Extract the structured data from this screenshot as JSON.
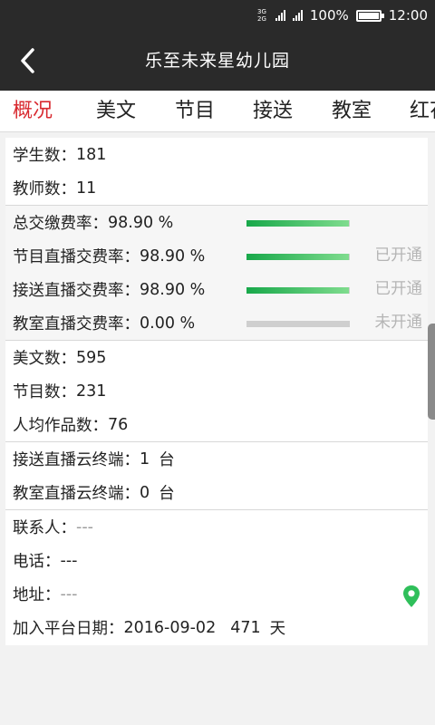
{
  "status_bar": {
    "net_top": "3G",
    "net_bottom": "2G",
    "battery_text": "100%",
    "battery_level": 1.0,
    "time": "12:00"
  },
  "app_bar": {
    "title": "乐至未来星幼儿园",
    "back_icon": "chevron-left-icon"
  },
  "tabs": [
    "概况",
    "美文",
    "节目",
    "接送",
    "教室",
    "红花"
  ],
  "active_tab": 0,
  "accent_color": "#d8292f",
  "bar_color": "#18a84a",
  "counts": {
    "students_label": "学生数：",
    "students_value": "181",
    "teachers_label": "教师数：",
    "teachers_value": "11"
  },
  "fees": [
    {
      "label": "总交缴费率：",
      "value": "98.90 %",
      "fraction": 0.989,
      "status": ""
    },
    {
      "label": "节目直播交费率：",
      "value": "98.90 %",
      "fraction": 0.989,
      "status": "已开通"
    },
    {
      "label": "接送直播交费率：",
      "value": "98.90 %",
      "fraction": 0.989,
      "status": "已开通"
    },
    {
      "label": "教室直播交费率：",
      "value": "0.00 %",
      "fraction": 0.0,
      "status": "未开通"
    }
  ],
  "works": {
    "articles_label": "美文数：",
    "articles_value": "595",
    "programs_label": "节目数：",
    "programs_value": "231",
    "avg_label": "人均作品数：",
    "avg_value": "76"
  },
  "terminals": {
    "pickup_label": "接送直播云终端：",
    "pickup_value": "1",
    "classroom_label": "教室直播云终端：",
    "classroom_value": "0",
    "unit": "台"
  },
  "contact": {
    "person_label": "联系人：",
    "person_value": "---",
    "phone_label": "电话：",
    "phone_value": "---",
    "address_label": "地址：",
    "address_value": "---",
    "location_icon": "map-pin-icon",
    "join_label": "加入平台日期：",
    "join_date": "2016-09-02",
    "join_days": "471",
    "days_unit": "天"
  }
}
